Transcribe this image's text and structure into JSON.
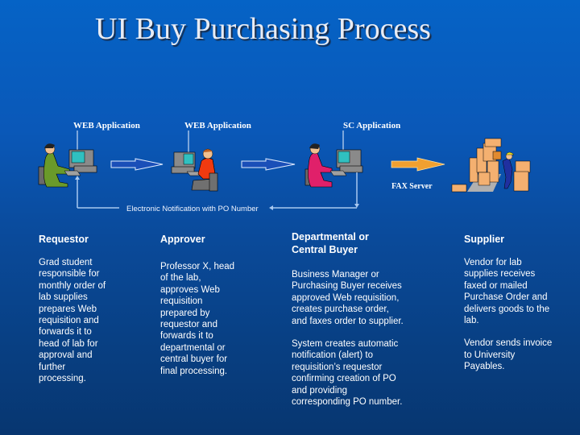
{
  "title": "UI Buy Purchasing Process",
  "diagram": {
    "apps": [
      {
        "label": "WEB Application"
      },
      {
        "label": "WEB Application"
      },
      {
        "label": "SC Application"
      }
    ],
    "fax_label": "FAX Server",
    "notification_label": "Electronic Notification with PO Number",
    "colors": {
      "flow_arrow": "#1a4fb8",
      "fax_arrow": "#f0a030",
      "connector": "#a8c8f0"
    }
  },
  "roles": [
    {
      "heading": "Requestor",
      "paragraphs": [
        "Grad student responsible for monthly order of lab supplies prepares Web requisition and forwards it to head of lab for approval and further processing."
      ]
    },
    {
      "heading": "Approver",
      "paragraphs": [
        "Professor X, head of the lab, approves Web requisition prepared by requestor and forwards it to departmental or central buyer for final processing."
      ]
    },
    {
      "heading": "Departmental or Central Buyer",
      "paragraphs": [
        "Business Manager or Purchasing Buyer receives approved Web requisition, creates purchase order, and faxes order to supplier.",
        "System creates automatic notification (alert)  to requisition’s requestor confirming creation of PO and providing corresponding PO number."
      ]
    },
    {
      "heading": "Supplier",
      "paragraphs": [
        "Vendor for lab supplies receives faxed or mailed Purchase Order and delivers goods to the lab.",
        "Vendor sends invoice to University Payables."
      ]
    }
  ]
}
